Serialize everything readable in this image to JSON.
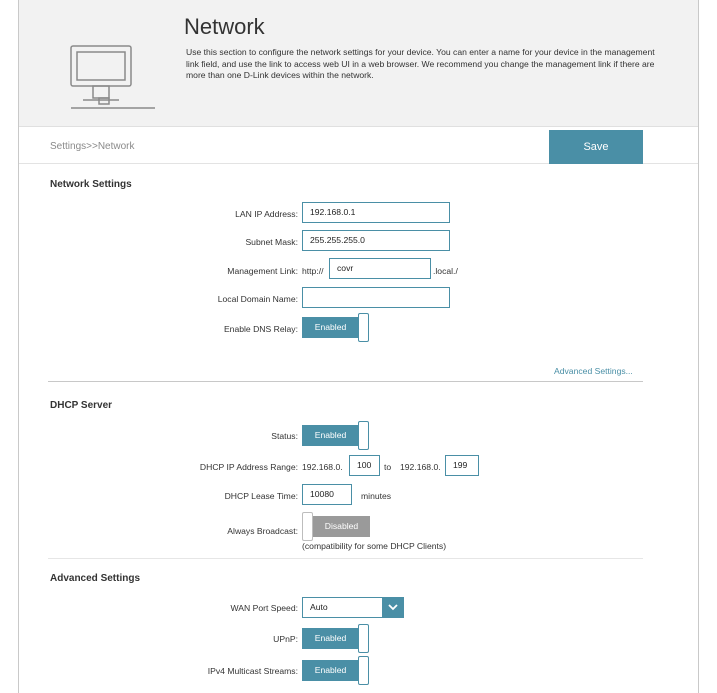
{
  "banner": {
    "title": "Network",
    "description": "Use this section to configure the network settings for your device. You can enter a name for your device in the management link field, and use the link to access web UI in a web browser. We recommend you change the management link if there are more than one D-Link devices within the network.",
    "icon": "network-computer-icon"
  },
  "breadcrumb": "Settings>>Network",
  "toolbar": {
    "save_label": "Save"
  },
  "colors": {
    "accent": "#4a8fa6",
    "disabled": "#9a9a9a",
    "banner_bg": "#f2f2f2"
  },
  "network_settings": {
    "title": "Network Settings",
    "lan_ip": {
      "label": "LAN IP Address",
      "value": "192.168.0.1"
    },
    "subnet": {
      "label": "Subnet Mask",
      "value": "255.255.255.0"
    },
    "mgmt": {
      "label": "Management Link",
      "prefix": "http://",
      "value": "covr",
      "suffix": ".local./"
    },
    "domain": {
      "label": "Local Domain Name",
      "value": ""
    },
    "dns_relay": {
      "label": "Enable DNS Relay",
      "state": "Enabled"
    },
    "advanced_link": "Advanced Settings..."
  },
  "dhcp": {
    "title": "DHCP Server",
    "status": {
      "label": "Status",
      "state": "Enabled"
    },
    "range": {
      "label": "DHCP IP Address Range",
      "prefix1": "192.168.0.",
      "start": "100",
      "to": "to",
      "prefix2": "192.168.0.",
      "end": "199"
    },
    "lease": {
      "label": "DHCP Lease Time",
      "value": "10080",
      "unit": "minutes"
    },
    "broadcast": {
      "label": "Always Broadcast",
      "state": "Disabled",
      "note": "(compatibility for some DHCP Clients)"
    }
  },
  "advanced": {
    "title": "Advanced Settings",
    "wan_speed": {
      "label": "WAN Port Speed",
      "value": "Auto"
    },
    "upnp": {
      "label": "UPnP",
      "state": "Enabled"
    },
    "ipv4_multicast": {
      "label": "IPv4 Multicast Streams",
      "state": "Enabled"
    }
  }
}
